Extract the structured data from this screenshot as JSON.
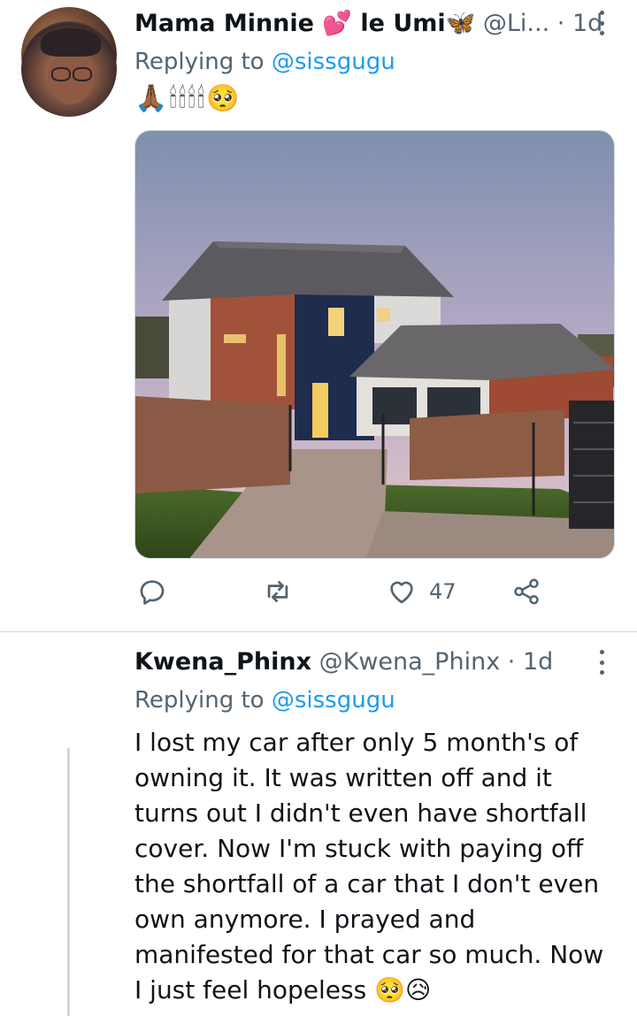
{
  "tweets": [
    {
      "name": "Mama Minnie 💕 le Umi🦋",
      "handle": "@Li...",
      "separator": "·",
      "time": "1d",
      "replying_prefix": "Replying to",
      "replying_to": "@sissgugu",
      "text": "🙏🏾🕯🕯🕯🕯🥺",
      "actions": {
        "reply_icon": "reply-icon",
        "retweet_icon": "retweet-icon",
        "like_icon": "heart-icon",
        "like_count": "47",
        "share_icon": "share-icon"
      }
    },
    {
      "name": "Kwena_Phinx",
      "handle": "@Kwena_Phinx",
      "separator": "·",
      "time": "1d",
      "replying_prefix": "Replying to",
      "replying_to": "@sissgugu",
      "text": "I lost my car after only 5 month's of owning it. It was written off and it turns out I didn't even have shortfall cover. Now I'm stuck with paying off the shortfall of a car that I don't even own anymore. I prayed and manifested for that car so much. Now I just feel hopeless 🥺😥"
    }
  ],
  "colors": {
    "accent": "#1d9bf0",
    "secondary_text": "#536471",
    "divider": "#cfd9de"
  }
}
